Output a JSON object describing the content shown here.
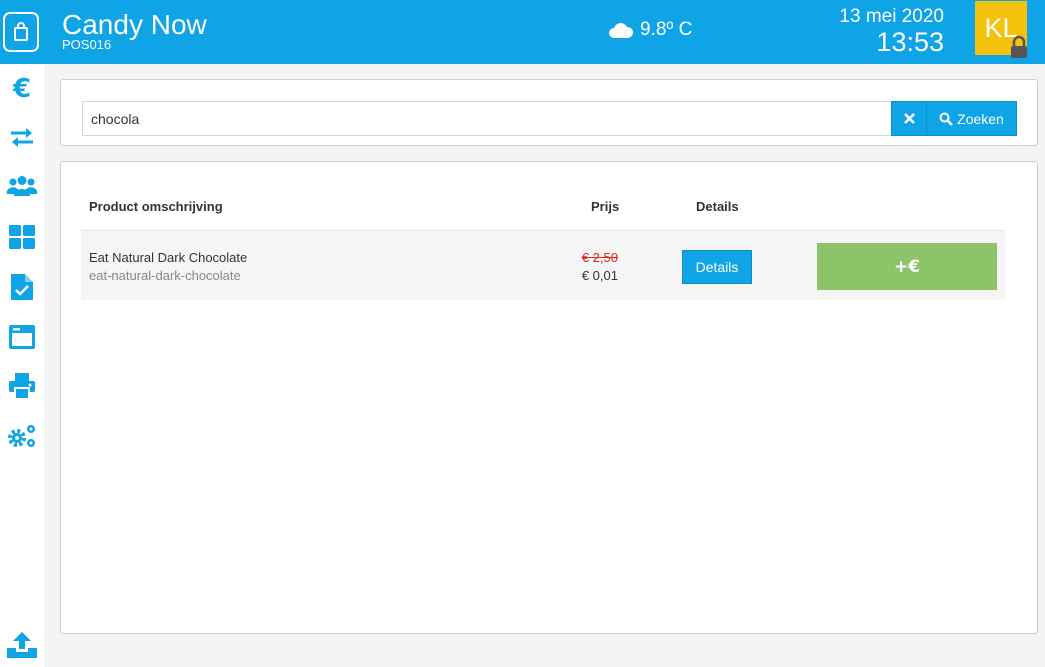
{
  "header": {
    "title": "Candy Now",
    "pos_id": "POS016",
    "weather": "9.8º C",
    "date": "13 mei 2020",
    "time": "13:53",
    "avatar_initials": "KL"
  },
  "sidebar": {
    "items": [
      "euro-icon",
      "transfer-icon",
      "users-icon",
      "dashboard-icon",
      "checklist-icon",
      "window-icon",
      "printer-icon",
      "settings-icon"
    ],
    "bottom": "upload-icon"
  },
  "search": {
    "value": "chocola",
    "button_label": "Zoeken"
  },
  "table": {
    "headers": {
      "description": "Product omschrijving",
      "price": "Prijs",
      "details": "Details"
    },
    "rows": [
      {
        "name": "Eat Natural Dark Chocolate",
        "slug": "eat-natural-dark-chocolate",
        "price_old": "€ 2,50",
        "price_new": "€ 0,01",
        "details_label": "Details",
        "add_label": "+€"
      }
    ]
  },
  "colors": {
    "primary": "#0ea4e6",
    "avatar": "#f4c20d",
    "add_button": "#8dc46a",
    "strike_price": "#d9251c"
  }
}
